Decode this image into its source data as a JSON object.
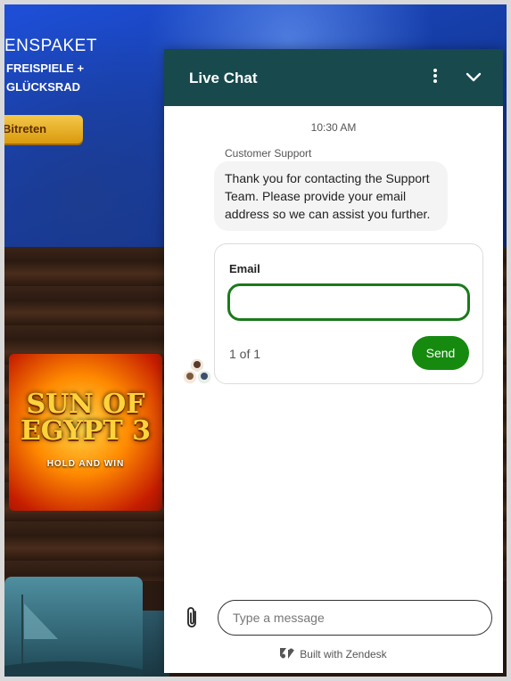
{
  "background_site": {
    "hero_title": "ENSPAKET",
    "hero_line2": "FREISPIELE +",
    "hero_line3": "GLÜCKSRAD",
    "join_label": "Bitreten",
    "game": {
      "title_line1": "SUN OF",
      "title_line2": "EGYPT 3",
      "subtitle": "HOLD AND WIN"
    }
  },
  "chat": {
    "header_title": "Live Chat",
    "menu_icon": "vertical-dots-icon",
    "collapse_icon": "chevron-down-icon",
    "timestamp": "10:30 AM",
    "sender": "Customer Support",
    "message": "Thank you for contacting the Support Team. Please provide your email address so we can assist you further.",
    "form": {
      "label": "Email",
      "value": "",
      "pager": "1 of 1",
      "send_label": "Send"
    },
    "composer": {
      "placeholder": "Type a message",
      "attach_icon": "paperclip-icon"
    },
    "footer": "Built with Zendesk"
  },
  "colors": {
    "header_bg": "#17494d",
    "send_button": "#158a0f",
    "input_border": "#1b7a1b"
  }
}
